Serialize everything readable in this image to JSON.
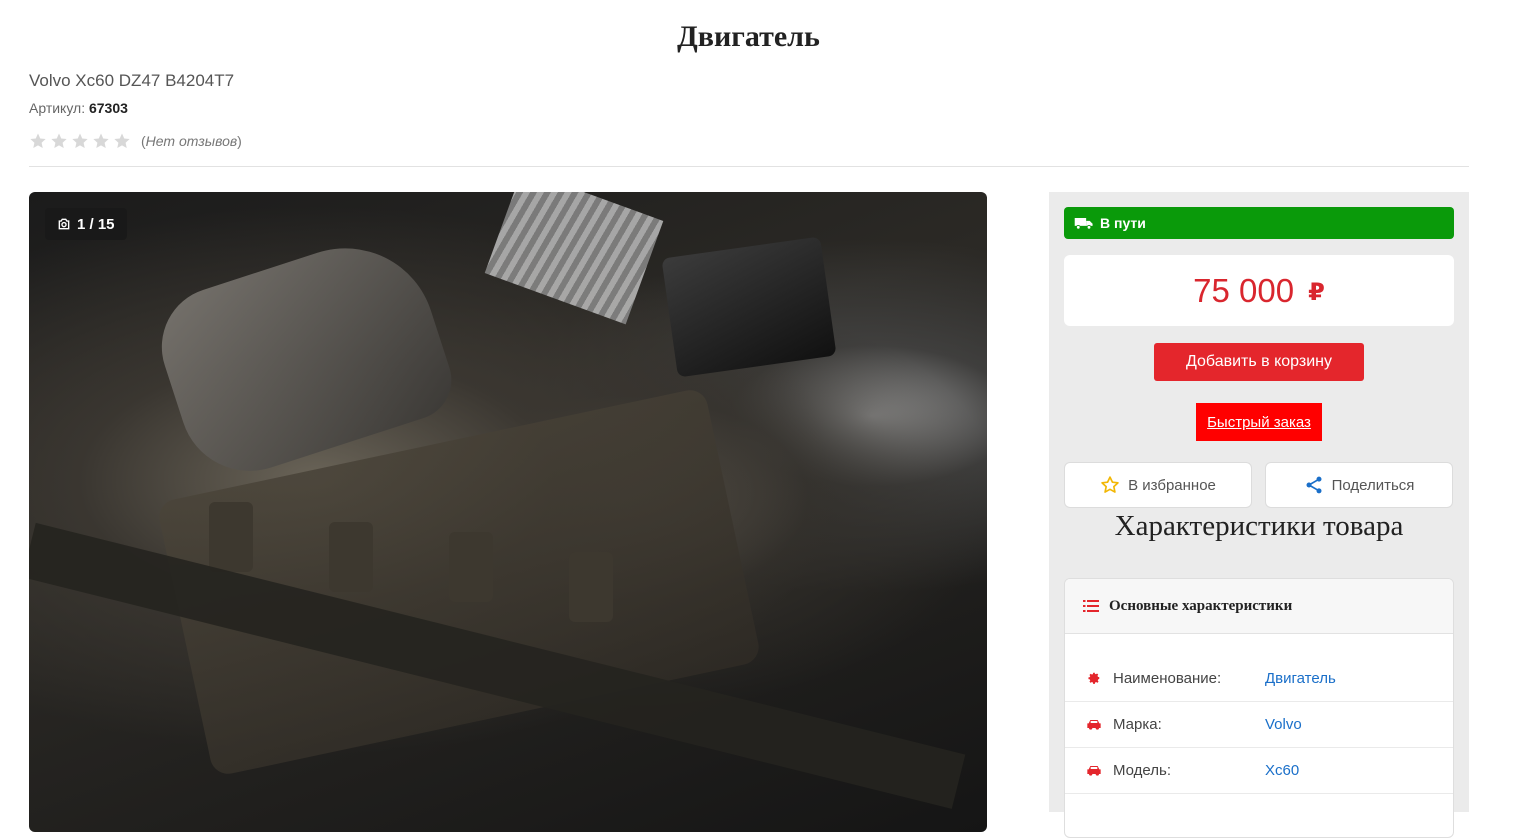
{
  "product": {
    "title": "Двигатель",
    "subtitle": "Volvo Xc60 DZ47 B4204T7",
    "sku_label": "Артикул:",
    "sku_value": "67303",
    "rating_stars": 0,
    "rating_max": 5,
    "reviews_text": "Нет отзывов"
  },
  "gallery": {
    "counter": "1 / 15",
    "camera_icon": "camera-icon"
  },
  "sidebar": {
    "status": "В пути",
    "status_color": "#0a9a0a",
    "price": "75 000",
    "currency": "₽",
    "price_color": "#d9262e",
    "add_to_cart": "Добавить в корзину",
    "quick_order": "Быстрый заказ",
    "favorite": "В избранное",
    "share": "Поделиться",
    "characteristics_title": "Характеристики товара",
    "characteristics_section": "Основные характеристики",
    "characteristics": [
      {
        "icon": "gear-icon",
        "key": "Наименование:",
        "value": "Двигатель"
      },
      {
        "icon": "car-icon",
        "key": "Марка:",
        "value": "Volvo"
      },
      {
        "icon": "car-icon",
        "key": "Модель:",
        "value": "Xc60"
      }
    ]
  }
}
